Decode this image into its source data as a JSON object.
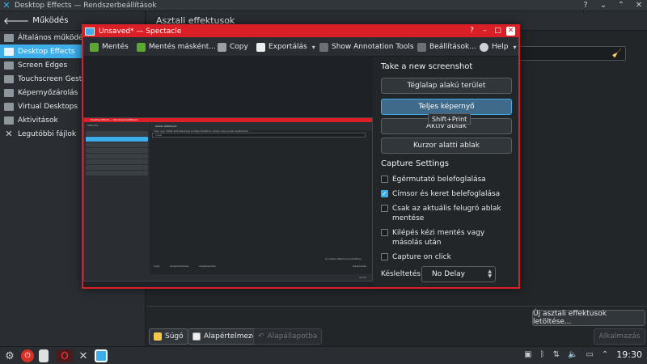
{
  "window": {
    "title": "Desktop Effects — Rendszerbeállítások",
    "controls": {
      "help": "?",
      "minimize": "⌄",
      "maximize": "⌃",
      "close": "✕"
    }
  },
  "sidebar": {
    "back_label": "Működés",
    "items": [
      {
        "label": "Általános működés",
        "icon": "settings-icon",
        "active": false
      },
      {
        "label": "Desktop Effects",
        "icon": "effects-icon",
        "active": true
      },
      {
        "label": "Screen Edges",
        "icon": "screen-edges-icon",
        "active": false
      },
      {
        "label": "Touchscreen Gestures",
        "icon": "touchscreen-icon",
        "active": false
      },
      {
        "label": "Képernyőzárolás",
        "icon": "lock-screen-icon",
        "active": false
      },
      {
        "label": "Virtual Desktops",
        "icon": "virtual-desktops-icon",
        "active": false
      },
      {
        "label": "Aktivitások",
        "icon": "activities-icon",
        "active": false
      },
      {
        "label": "Legutóbbi fájlok",
        "icon": "tools-icon",
        "active": false
      }
    ]
  },
  "content": {
    "heading": "Asztali effektusok",
    "download_button": "Új asztali effektusok letöltése...",
    "buttons": {
      "help": "Súgó",
      "defaults": "Alapértelmezés",
      "reset": "Alapállapotba",
      "apply": "Alkalmazás"
    }
  },
  "spectacle": {
    "title": "Unsaved* — Spectacle",
    "toolbar": {
      "save": "Mentés",
      "save_as": "Mentés másként...",
      "copy": "Copy",
      "export": "Exportálás",
      "annotate": "Show Annotation Tools",
      "settings": "Beállítások...",
      "help": "Help"
    },
    "new_shot_heading": "Take a new screenshot",
    "capture_buttons": {
      "rect": "Téglalap alakú terület",
      "full": "Teljes képernyő",
      "active": "Aktív ablak",
      "under_cursor": "Kurzor alatti ablak"
    },
    "tooltip": "Shift+Print",
    "capture_settings_heading": "Capture Settings",
    "options": [
      {
        "label": "Egérmutató belefoglalása",
        "checked": false
      },
      {
        "label": "Címsor és keret belefoglalása",
        "checked": true
      },
      {
        "label": "Csak az aktuális felugró ablak mentése",
        "checked": false
      },
      {
        "label": "Kilépés kézi mentés vagy másolás után",
        "checked": false
      },
      {
        "label": "Capture on click",
        "checked": false
      }
    ],
    "delay_label": "Késleltetés:",
    "delay_value": "No Delay",
    "thumbnail": {
      "title": "Desktop Effects — Rendszerbeállítások",
      "heading": "Asztali effektusok",
      "back": "Működés",
      "items": [
        "Általános működés",
        "Desktop Effects",
        "Screen Edges",
        "Touchscreen Gestures",
        "Képernyőzárolás",
        "Virtual Desktops",
        "Aktivitások",
        "Legutóbbi fájlok"
      ],
      "hint": "Tipp: egy effekt aktiválásának konfigurálásához nézze meg annak beállításait.",
      "field": "cover",
      "buttons": [
        "Súgó",
        "Alapértelmezés",
        "Alapállapotba"
      ],
      "download": "Új asztali effektusok letöltése...",
      "apply": "Alkalmazás",
      "clock": "19:30"
    }
  },
  "taskbar": {
    "clock": "19:30",
    "apps": [
      "app-launcher-icon",
      "stop-icon",
      "trash-icon",
      "opera-icon",
      "system-tools-icon",
      "spectacle-icon"
    ],
    "tray": [
      "clipboard-icon",
      "bluetooth-icon",
      "network-icon",
      "volume-icon",
      "display-icon",
      "expand-tray-icon"
    ]
  }
}
